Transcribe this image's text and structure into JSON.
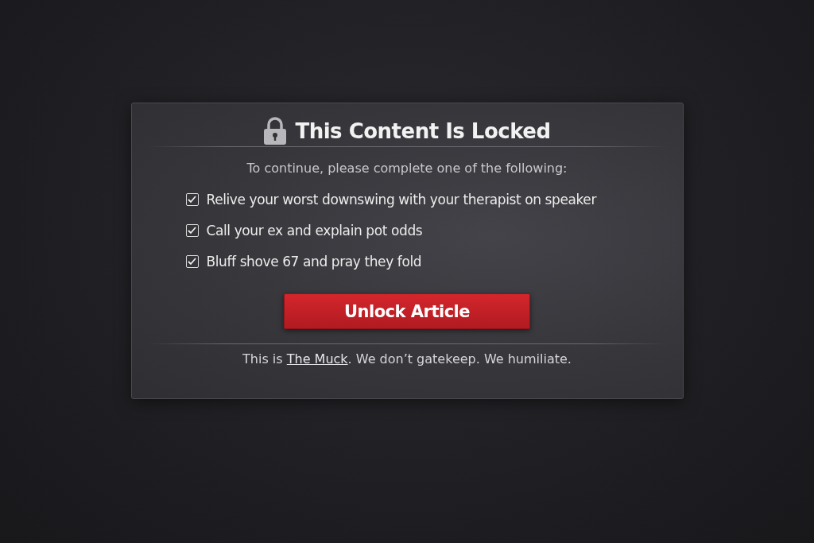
{
  "dialog": {
    "title": "This Content Is Locked",
    "instructions": "To continue, please complete one of the following:",
    "options": [
      {
        "label": "Relive your worst downswing with your therapist on speaker",
        "checked": true
      },
      {
        "label": "Call your ex and explain pot odds",
        "checked": true
      },
      {
        "label": "Bluff shove 67 and pray they fold",
        "checked": true
      }
    ],
    "button": "Unlock Article",
    "footer": {
      "before": "This is ",
      "link": "The Muck",
      "after": ". We don’t gatekeep. We humiliate."
    }
  }
}
